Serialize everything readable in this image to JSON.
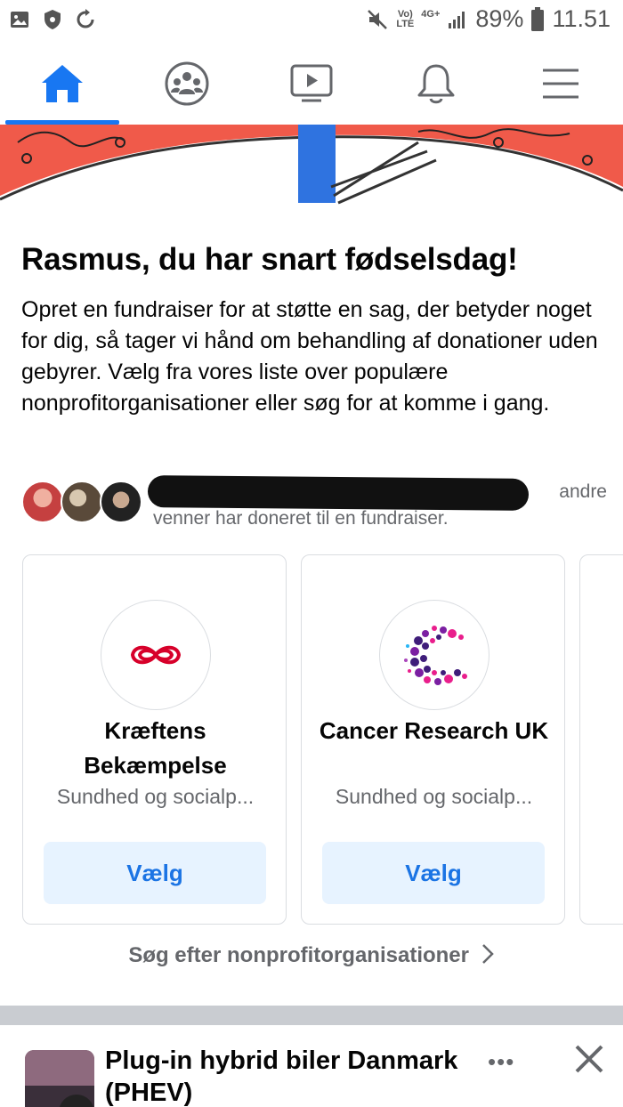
{
  "status_bar": {
    "network_top": "Vo)",
    "network_bottom": "LTE",
    "signal_type": "4G+",
    "battery": "89%",
    "time": "11.51"
  },
  "nav": {
    "items": [
      "home-icon",
      "groups-icon",
      "watch-icon",
      "notifications-icon",
      "menu-icon"
    ],
    "active": "home",
    "accent": "#1877f2"
  },
  "birthday": {
    "title": "Rasmus, du har snart fødselsdag!",
    "description": "Opret en fundraiser for at støtte en sag, der betyder noget for dig, så tager vi hånd om behandling af donationer uden gebyrer. Vælg fra vores liste over populære nonprofitorganisationer eller søg for at komme i gang.",
    "friends_text_suffix": "andre",
    "friends_text_line2": "venner har doneret til en fundraiser."
  },
  "orgs": [
    {
      "name": "Kræftens Bekæmpelse",
      "category": "Sundhed og socialp...",
      "button": "Vælg"
    },
    {
      "name": "Cancer Research UK",
      "category": "Sundhed og socialp...",
      "button": "Vælg"
    }
  ],
  "search_link": "Søg efter nonprofitorganisationer",
  "suggested_group": {
    "name": "Plug-in hybrid biler Danmark (PHEV)",
    "more_label": "•••"
  },
  "colors": {
    "brand_blue": "#1877f2",
    "button_bg": "#e7f3ff",
    "secondary_text": "#65676b",
    "kb_red": "#d7002a"
  }
}
